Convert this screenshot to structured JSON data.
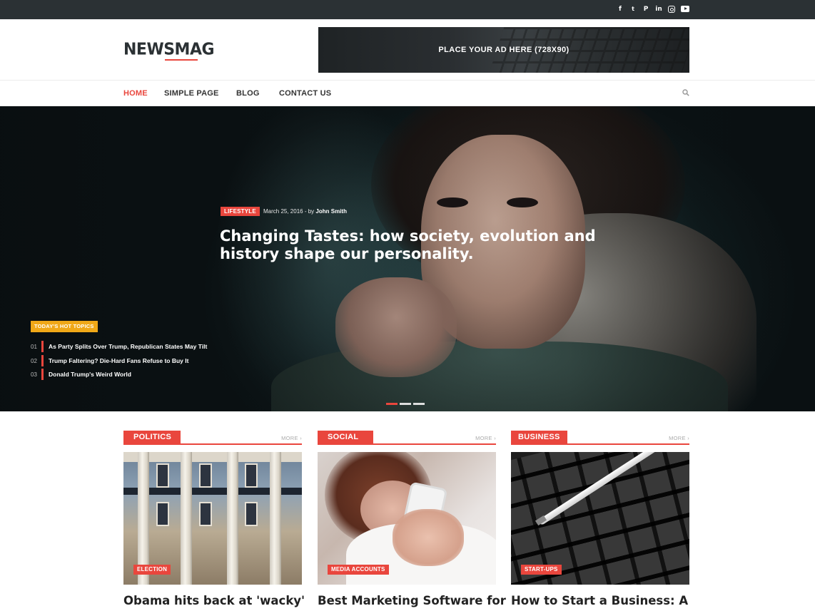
{
  "topbar": {
    "social": [
      {
        "icon": "facebook-icon",
        "glyph": "f"
      },
      {
        "icon": "twitter-icon",
        "glyph": "🐦"
      },
      {
        "icon": "pinterest-icon",
        "glyph": "P"
      },
      {
        "icon": "linkedin-icon",
        "glyph": "in"
      },
      {
        "icon": "instagram-icon",
        "glyph": ""
      },
      {
        "icon": "youtube-icon",
        "glyph": ""
      }
    ]
  },
  "header": {
    "logo": "NEWSMAG",
    "ad_text": "PLACE YOUR AD HERE (728X90)"
  },
  "nav": {
    "items": [
      "HOME",
      "SIMPLE PAGE",
      "BLOG",
      "CONTACT US"
    ],
    "active": "HOME"
  },
  "hero": {
    "category": "LIFESTYLE",
    "date": "March 25, 2016",
    "by": "- by",
    "author": "John Smith",
    "title_line1": "Changing Tastes: how society, evolution and",
    "title_line2": "history shape our personality.",
    "hot_topics_label": "TODAY'S HOT TOPICS",
    "hot_topics": [
      {
        "num": "01",
        "text": "As Party Splits Over Trump, Republican States May Tilt"
      },
      {
        "num": "02",
        "text": "Trump Faltering? Die-Hard Fans Refuse to Buy It"
      },
      {
        "num": "03",
        "text": "Donald Trump's Weird World"
      }
    ],
    "slider_active": 1
  },
  "columns": [
    {
      "section": "POLITICS",
      "more": "MORE ›",
      "tag": "ELECTION",
      "title": "Obama hits back at 'wacky'"
    },
    {
      "section": "SOCIAL",
      "more": "MORE ›",
      "tag": "MEDIA ACCOUNTS",
      "title": "Best Marketing Software for"
    },
    {
      "section": "BUSINESS",
      "more": "MORE ›",
      "tag": "START-UPS",
      "title": "How to Start a Business: A"
    }
  ],
  "colors": {
    "accent": "#e9463d",
    "hot": "#f0a818",
    "topbar": "#2b3134"
  }
}
